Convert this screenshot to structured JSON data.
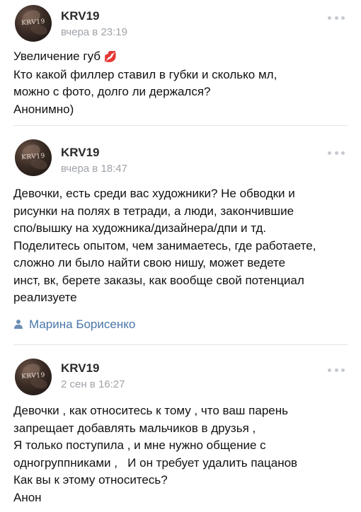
{
  "posts": [
    {
      "author": "KRV19",
      "avatar_text": "KRV19",
      "time": "вчера в 23:19",
      "lines": [
        "Увеличение губ",
        "Кто какой филлер ставил в губки и сколько мл,",
        "можно с фото, долго ли держался?",
        "Анонимно)"
      ],
      "emoji": "💋",
      "signer": ""
    },
    {
      "author": "KRV19",
      "avatar_text": "KRV19",
      "time": "вчера в 18:47",
      "lines": [
        "Девочки, есть среди вас художники? Не обводки и",
        "рисунки на полях в тетради, а люди, закончившие",
        "спо/вышку на художника/дизайнера/дпи и тд.",
        "Поделитесь опытом, чем занимаетесь, где работаете,",
        "сложно ли было найти свою нишу, может ведете",
        "инст, вк, берете заказы, как вообще свой потенциал",
        "реализуете"
      ],
      "signer": "Марина Борисенко"
    },
    {
      "author": "KRV19",
      "avatar_text": "KRV19",
      "time": "2 сен в 16:27",
      "lines": [
        "Девочки , как относитесь к тому , что ваш парень",
        "запрещает добавлять мальчиков в друзья ,",
        "Я только поступила , и мне нужно общение с",
        "одногруппниками ,   И он требует удалить пацанов",
        "Как вы к этому относитесь?",
        "Анон"
      ],
      "signer": ""
    }
  ],
  "icons": {
    "more": "more-horizontal-icon",
    "signer": "person-icon",
    "emoji": "lips-emoji-icon"
  },
  "colors": {
    "link": "#4a76a8",
    "secondary": "#9ea3a8",
    "divider": "#e3e4e7",
    "dots": "#c5c9ce"
  }
}
